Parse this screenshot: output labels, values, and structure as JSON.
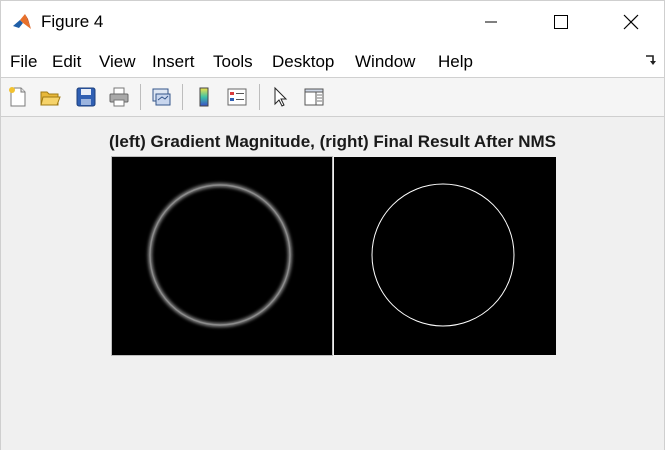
{
  "window": {
    "title": "Figure 4",
    "icon": "matlab-logo-icon"
  },
  "window_controls": {
    "minimize": "minimize-icon",
    "maximize": "maximize-icon",
    "close": "close-icon"
  },
  "menu": {
    "items": [
      "File",
      "Edit",
      "View",
      "Insert",
      "Tools",
      "Desktop",
      "Window",
      "Help"
    ]
  },
  "toolbar": {
    "icons": [
      "new-figure-icon",
      "open-file-icon",
      "save-icon",
      "print-icon",
      "link-plot-icon",
      "colorbar-icon",
      "legend-icon",
      "edit-plot-arrow-icon",
      "property-inspector-icon"
    ]
  },
  "figure": {
    "title": "(left) Gradient Magnitude, (right) Final Result After NMS",
    "panels": [
      {
        "name": "gradient-magnitude",
        "content": "blurred gray ring on black"
      },
      {
        "name": "nms-result",
        "content": "thin white circle on black"
      }
    ]
  },
  "colors": {
    "background": "#f0f0f0",
    "titlebar": "#ffffff",
    "panel_bg": "#000000",
    "ring_gray": "#8a8a8a",
    "circle_white": "#ffffff"
  }
}
